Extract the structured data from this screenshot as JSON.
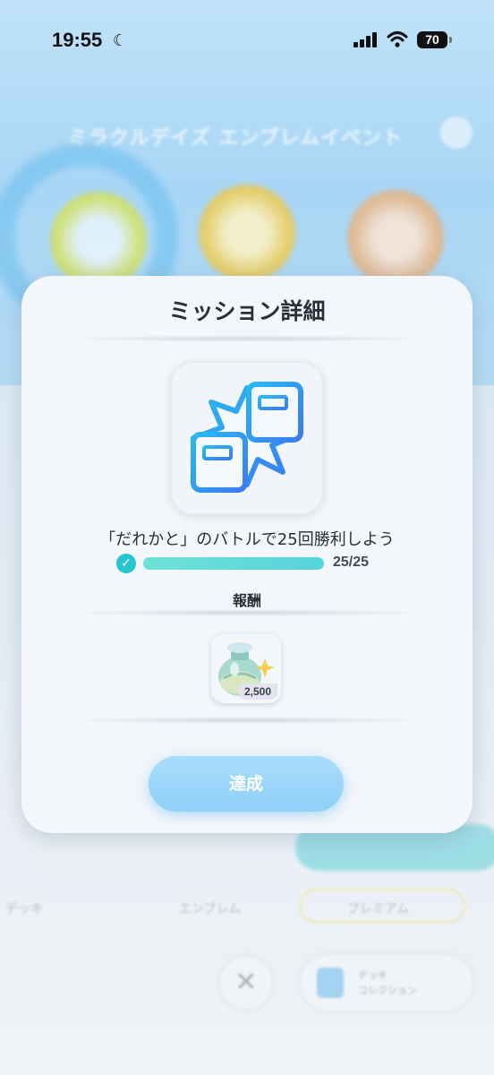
{
  "status_bar": {
    "time": "19:55",
    "battery": "70",
    "icons": [
      "moon-icon",
      "signal-icon",
      "wifi-icon",
      "battery-icon"
    ]
  },
  "background": {
    "event_title": "ミラクルデイズ エンブレムイベント",
    "tabs": [
      "デッキ",
      "エンブレム",
      "プレミアム"
    ],
    "collection_button": [
      "デッキ",
      "コレクション"
    ]
  },
  "modal": {
    "title": "ミッション詳細",
    "mission_icon": "battle-versus-icon",
    "mission_text": "「だれかと」のバトルで25回勝利しよう",
    "progress": {
      "current": 25,
      "target": 25,
      "fraction": 1.0,
      "text": "25/25",
      "completed": true
    },
    "reward_label": "報酬",
    "reward": {
      "icon": "shinedust-bottle-icon",
      "count": "2,500"
    },
    "achieve_button": "達成"
  },
  "colors": {
    "accent_teal": "#25c6d0",
    "progress_fill": "#5dd8d8",
    "button_blue": "#9bd5f9",
    "modal_bg": "#f3f6fa"
  }
}
